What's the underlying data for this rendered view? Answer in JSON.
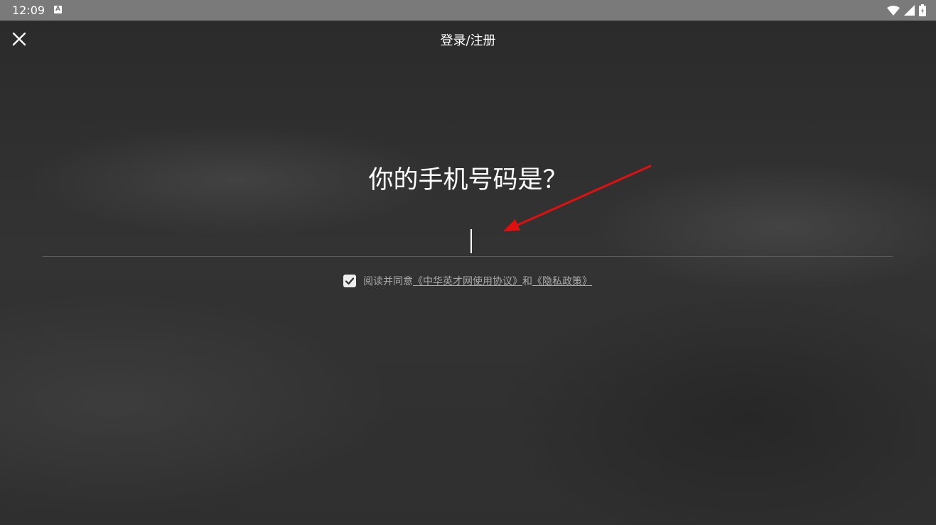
{
  "status_bar": {
    "time": "12:09",
    "notification_icon": "a-box-icon",
    "notification_glyph": "A",
    "icons": [
      "wifi-icon",
      "signal-icon",
      "battery-icon"
    ]
  },
  "header": {
    "close_icon": "close-icon",
    "title": "登录/注册"
  },
  "main": {
    "question": "你的手机号码是？",
    "phone_input": {
      "value": "",
      "placeholder": ""
    },
    "agreement": {
      "checked": true,
      "prefix": "阅读并同意",
      "terms_link": "《中华英才网使用协议》",
      "conjunction": "和",
      "privacy_link": "《隐私政策》"
    }
  },
  "annotation": {
    "arrow_color": "#e01010"
  },
  "colors": {
    "status_bar_bg": "#7a7a7a",
    "background": "#2c2c2c",
    "text_primary": "#ffffff",
    "text_secondary": "#a9a9a9"
  }
}
